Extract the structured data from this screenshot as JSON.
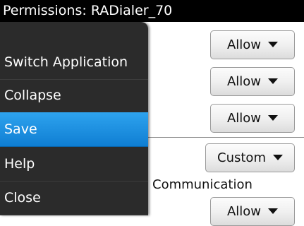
{
  "title": "Permissions: RADialer_70",
  "permissions": {
    "dropdowns": [
      "Allow",
      "Allow",
      "Allow",
      "Custom",
      "Allow"
    ],
    "section_label": "Communication"
  },
  "menu": {
    "items": [
      "Switch Application",
      "Collapse",
      "Save",
      "Help",
      "Close"
    ],
    "selected": "Save"
  },
  "colors": {
    "titlebar": "#000000",
    "menu_background": "#2b2b2b",
    "selection": "#1a8be0"
  },
  "icons": {
    "dropdown": "caret-down-icon"
  }
}
